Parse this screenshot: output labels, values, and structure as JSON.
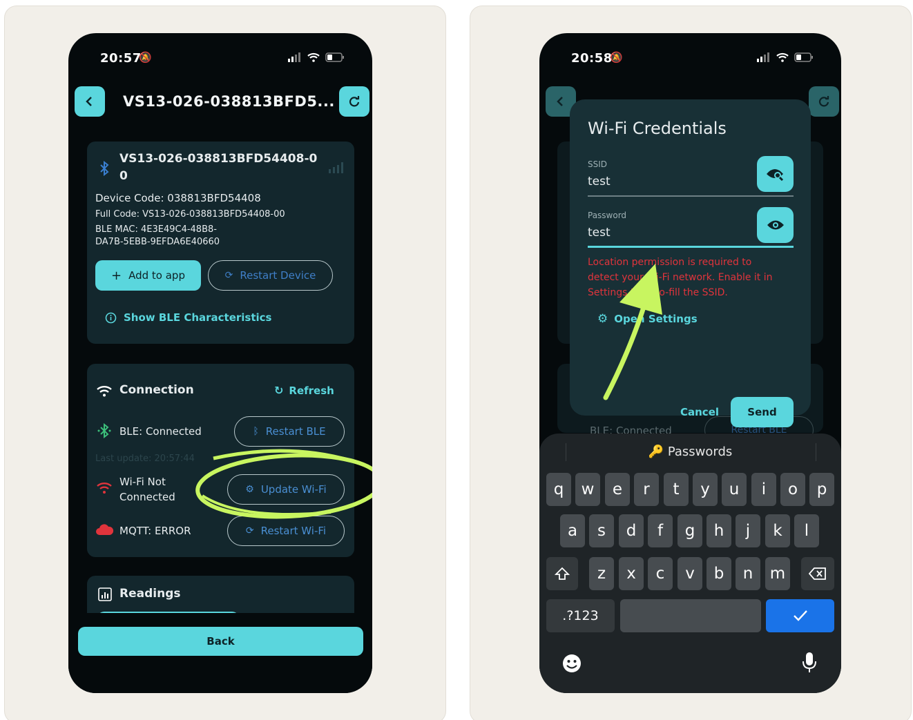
{
  "left_screen": {
    "status_time": "20:57",
    "header_title": "VS13-026-038813BFD5...",
    "device": {
      "name_line1": "VS13-026-038813BFD54408-0",
      "name_line2": "0",
      "device_code": "Device Code: 038813BFD54408",
      "full_code": "Full Code: VS13-026-038813BFD54408-00",
      "ble_mac_line1": "BLE MAC: 4E3E49C4-48B8-",
      "ble_mac_line2": "DA7B-5EBB-9EFDA6E40660",
      "add_to_app": "Add to app",
      "restart_device": "Restart Device",
      "show_ble": "Show BLE Characteristics"
    },
    "connection": {
      "title": "Connection",
      "refresh": "Refresh",
      "ble_status": "BLE: Connected",
      "restart_ble": "Restart BLE",
      "last_update": "Last update: 20:57:44",
      "wifi_line1": "Wi-Fi Not",
      "wifi_line2": "Connected",
      "update_wifi": "Update Wi-Fi",
      "mqtt_status": "MQTT: ERROR",
      "restart_wifi": "Restart Wi-Fi"
    },
    "readings_title": "Readings",
    "back_label": "Back"
  },
  "right_screen": {
    "status_time": "20:58",
    "background_ble": "BLE: Connected",
    "background_restart_ble": "Restart BLE",
    "dialog": {
      "title": "Wi-Fi Credentials",
      "ssid_label": "SSID",
      "ssid_value": "test",
      "password_label": "Password",
      "password_value": "test",
      "error_line1": "Location permission is required to",
      "error_line2": "detect your Wi-Fi network. Enable it in",
      "error_line3": "Settings to auto-fill the SSID.",
      "open_settings": "Open Settings",
      "cancel": "Cancel",
      "send": "Send"
    },
    "keyboard": {
      "suggestion": "Passwords",
      "row1": [
        "q",
        "w",
        "e",
        "r",
        "t",
        "y",
        "u",
        "i",
        "o",
        "p"
      ],
      "row2": [
        "a",
        "s",
        "d",
        "f",
        "g",
        "h",
        "j",
        "k",
        "l"
      ],
      "row3": [
        "z",
        "x",
        "c",
        "v",
        "b",
        "n",
        "m"
      ],
      "numbers_key": ".?123"
    }
  },
  "colors": {
    "accent": "#5ad6dd",
    "phone_bg": "#050a0c",
    "panel_bg": "#13272d",
    "error_red": "#e0343c",
    "highlight_green": "#c8f560",
    "keyboard_confirm": "#1a73e8"
  },
  "icons": {
    "back": "chevron-left-icon",
    "refresh": "refresh-icon",
    "bluetooth": "bluetooth-icon",
    "wifi": "wifi-icon",
    "cloud": "cloud-icon",
    "plus": "plus-icon",
    "info": "info-icon",
    "eye": "eye-icon",
    "gear": "gear-icon",
    "mic": "mic-icon",
    "emoji": "emoji-icon"
  }
}
